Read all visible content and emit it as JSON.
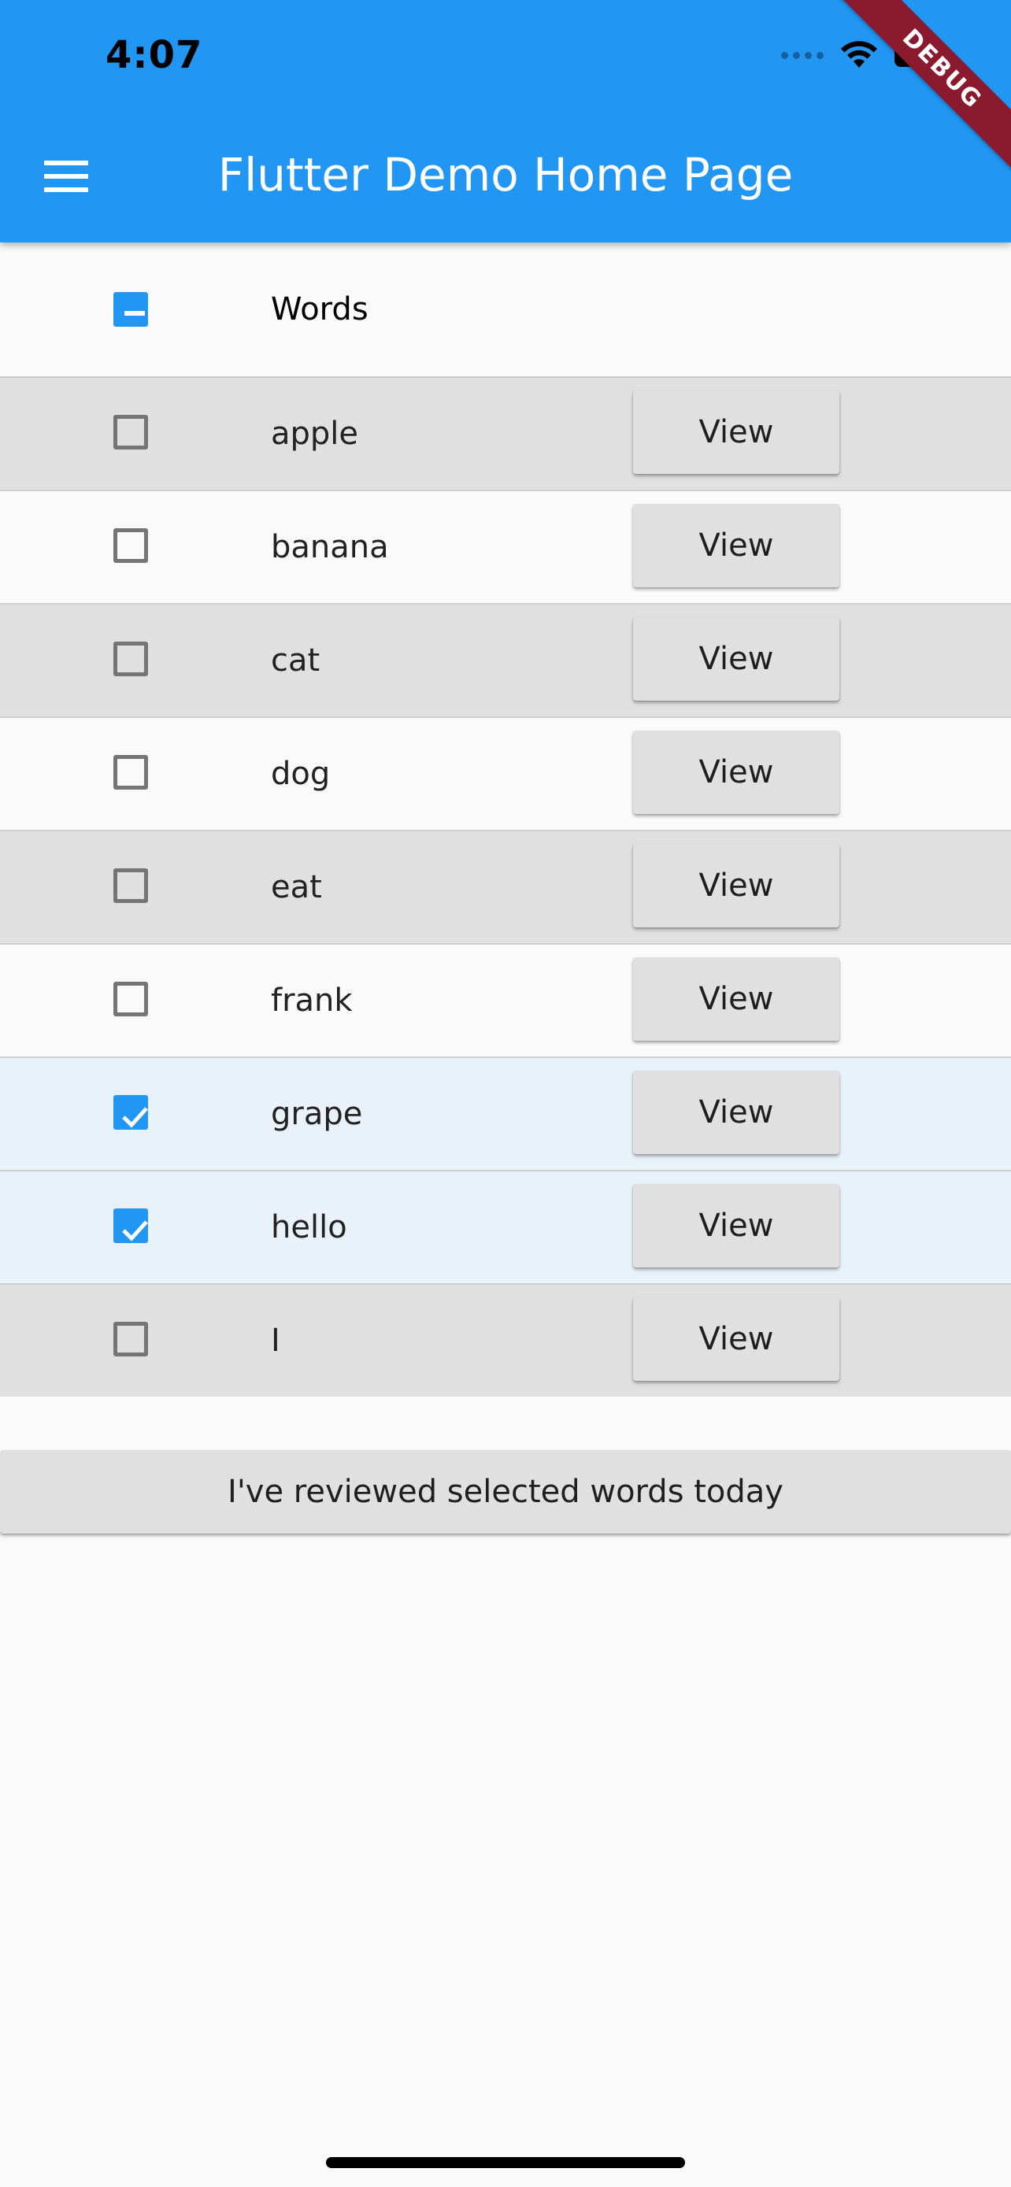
{
  "status_bar": {
    "time": "4:07",
    "wifi_icon": "wifi-icon",
    "battery_icon": "battery-icon"
  },
  "app_bar": {
    "title": "Flutter Demo Home Page",
    "menu_icon": "menu-icon",
    "color": "#2196f3"
  },
  "debug_banner": {
    "label": "DEBUG",
    "color": "#8b1a2e"
  },
  "table": {
    "header": {
      "label": "Words",
      "select_all_state": "indeterminate"
    },
    "rows": [
      {
        "word": "apple",
        "button": "View",
        "checked": false
      },
      {
        "word": "banana",
        "button": "View",
        "checked": false
      },
      {
        "word": "cat",
        "button": "View",
        "checked": false
      },
      {
        "word": "dog",
        "button": "View",
        "checked": false
      },
      {
        "word": "eat",
        "button": "View",
        "checked": false
      },
      {
        "word": "frank",
        "button": "View",
        "checked": false
      },
      {
        "word": "grape",
        "button": "View",
        "checked": true
      },
      {
        "word": "hello",
        "button": "View",
        "checked": true
      },
      {
        "word": "I",
        "button": "View",
        "checked": false
      }
    ],
    "checkbox_color": "#2196f3",
    "selected_row_color": "#e9f2fb"
  },
  "footer": {
    "reviewed_button": "I've reviewed selected words today"
  }
}
